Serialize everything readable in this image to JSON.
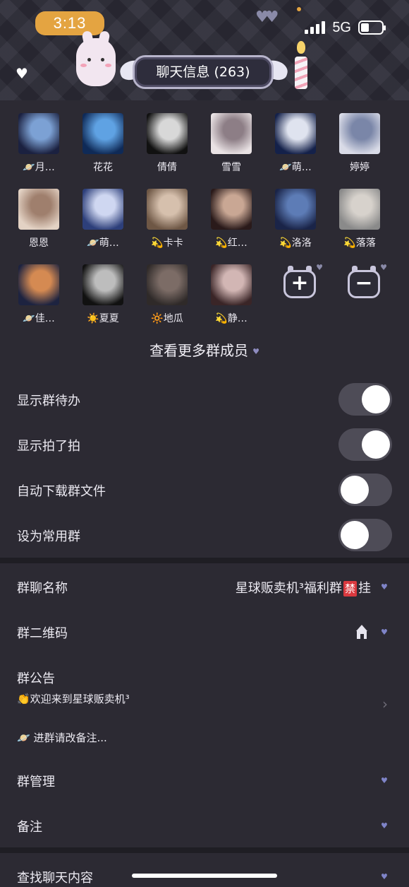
{
  "status_bar": {
    "time": "3:13",
    "network": "5G"
  },
  "header": {
    "title": "聊天信息 (263)"
  },
  "members": [
    {
      "name": "🪐月…",
      "av_colors": [
        "#1b2140",
        "#7ca1d4"
      ]
    },
    {
      "name": "花花",
      "av_colors": [
        "#0f2a57",
        "#5fa2e3"
      ]
    },
    {
      "name": "倩倩",
      "av_colors": [
        "#111111",
        "#d8d8d8"
      ]
    },
    {
      "name": "雪雪",
      "av_colors": [
        "#e9e2e4",
        "#8d7e86"
      ]
    },
    {
      "name": "🪐萌…",
      "av_colors": [
        "#14214a",
        "#dfe3ef"
      ]
    },
    {
      "name": "婷婷",
      "av_colors": [
        "#d9dbe7",
        "#7a86a8"
      ]
    },
    {
      "name": "恩恩",
      "av_colors": [
        "#e3d2c4",
        "#9f7f6d"
      ]
    },
    {
      "name": "🪐萌…",
      "av_colors": [
        "#2d3f7a",
        "#cfd7f1"
      ]
    },
    {
      "name": "💫卡卡",
      "av_colors": [
        "#6e5745",
        "#d6c0ad"
      ]
    },
    {
      "name": "💫红…",
      "av_colors": [
        "#2a1a1a",
        "#c9a794"
      ]
    },
    {
      "name": "💫洛洛",
      "av_colors": [
        "#1a2448",
        "#5d7cb6"
      ]
    },
    {
      "name": "💫落落",
      "av_colors": [
        "#8a8a8a",
        "#d7d2cc"
      ]
    },
    {
      "name": "🪐佳…",
      "av_colors": [
        "#1d2340",
        "#d58a52"
      ]
    },
    {
      "name": "☀️夏夏",
      "av_colors": [
        "#111111",
        "#bdbdbd"
      ]
    },
    {
      "name": "🔆地瓜",
      "av_colors": [
        "#2f2a29",
        "#7c6c66"
      ]
    },
    {
      "name": "💫静…",
      "av_colors": [
        "#3a2527",
        "#d2b6b4"
      ]
    }
  ],
  "actions": {
    "add_symbol": "+",
    "remove_symbol": "−"
  },
  "more_members": "查看更多群成员",
  "toggles": [
    {
      "label": "显示群待办",
      "on": true
    },
    {
      "label": "显示拍了拍",
      "on": true
    },
    {
      "label": "自动下载群文件",
      "on": false
    },
    {
      "label": "设为常用群",
      "on": false
    }
  ],
  "rows": {
    "group_name": {
      "label": "群聊名称",
      "value_prefix": "星球贩卖机³福利群",
      "value_badge": "禁",
      "value_suffix": "挂"
    },
    "qr_code": {
      "label": "群二维码"
    },
    "announcement": {
      "label": "群公告",
      "line1": "👏欢迎来到星球贩卖机³",
      "line2": "🪐 进群请改备注..."
    },
    "manage": {
      "label": "群管理"
    },
    "remark": {
      "label": "备注"
    },
    "search": {
      "label": "查找聊天内容"
    }
  }
}
